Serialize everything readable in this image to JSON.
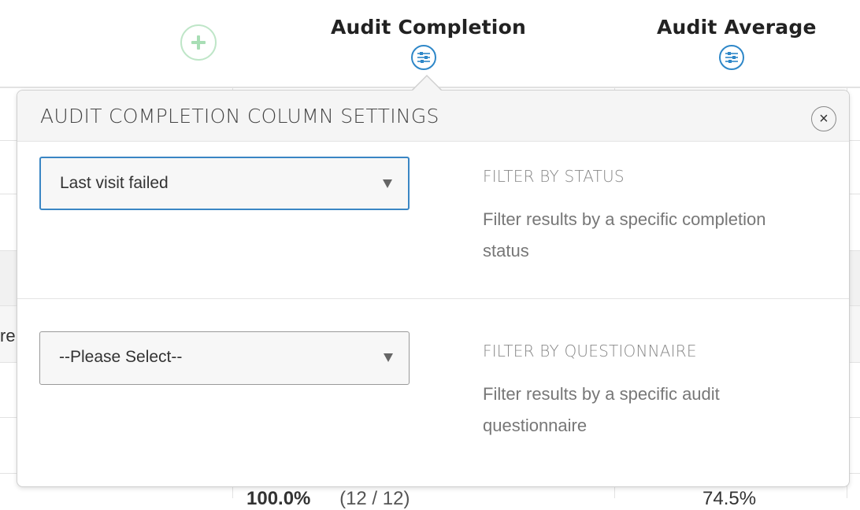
{
  "header": {
    "add_column_icon": "plus-icon",
    "columns": [
      {
        "title": "Audit Completion",
        "settings_icon": "sliders-icon"
      },
      {
        "title": "Audit Average",
        "settings_icon": "sliders-icon"
      }
    ]
  },
  "table": {
    "row_fragment": "re",
    "bottom_row": {
      "completion_pct": "100.0%",
      "completion_count": "(12 / 12)",
      "average": "74.5%"
    }
  },
  "popover": {
    "title": "AUDIT COMPLETION COLUMN SETTINGS",
    "close_label": "×",
    "status_filter": {
      "selected": "Last visit failed",
      "label": "FILTER BY STATUS",
      "description": "Filter results by a specific completion status"
    },
    "questionnaire_filter": {
      "selected": "--Please Select--",
      "label": "FILTER BY QUESTIONNAIRE",
      "description": "Filter results by a specific audit questionnaire"
    }
  },
  "colors": {
    "accent_blue": "#2e87c8",
    "add_green": "#bfe6c8",
    "active_border": "#3a86c4"
  }
}
